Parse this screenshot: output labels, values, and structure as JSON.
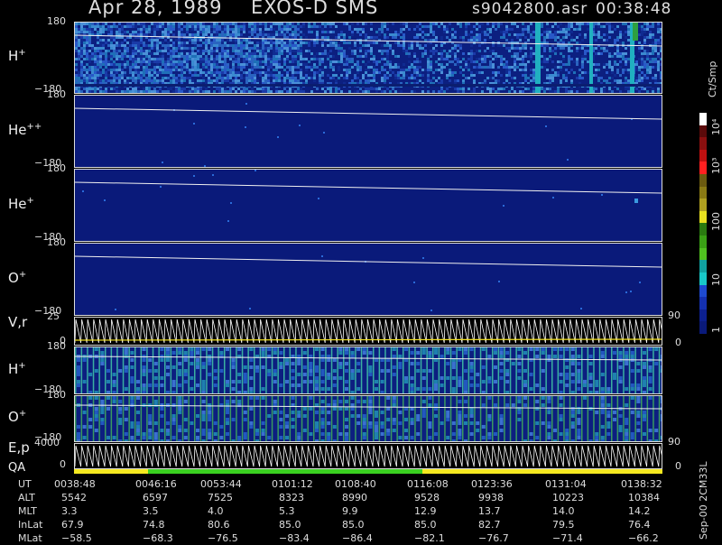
{
  "header": {
    "date": "Apr 28, 1989",
    "instrument": "EXOS-D SMS",
    "file": "s9042800.asr",
    "time": "00:38:48"
  },
  "panels": [
    {
      "id": "hplus1",
      "label": "H",
      "sup": "+",
      "top_tick": "180",
      "bottom_tick": "−180",
      "bg": "#0c1f80"
    },
    {
      "id": "hepp",
      "label": "He",
      "sup": "++",
      "top_tick": "180",
      "bottom_tick": "−180",
      "bg": "#0a1a7a"
    },
    {
      "id": "heplus",
      "label": "He",
      "sup": "+",
      "top_tick": "180",
      "bottom_tick": "−180",
      "bg": "#0a1a7a"
    },
    {
      "id": "oplus1",
      "label": "O",
      "sup": "+",
      "top_tick": "180",
      "bottom_tick": "−180",
      "bg": "#0a1a7a"
    },
    {
      "id": "vr",
      "label": "V,r",
      "sup": "",
      "top_tick": "25",
      "bottom_tick": "0",
      "right_top": "90",
      "right_bottom": "0",
      "bg": "#000"
    },
    {
      "id": "hplus2",
      "label": "H",
      "sup": "+",
      "top_tick": "180",
      "bottom_tick": "−180",
      "bg": "#0c1f80"
    },
    {
      "id": "oplus2",
      "label": "O",
      "sup": "+",
      "top_tick": "180",
      "bottom_tick": "−180",
      "bg": "#0c1f80"
    },
    {
      "id": "ep",
      "label": "E,p",
      "sup": "",
      "top_tick": "4000",
      "bottom_tick": "0",
      "right_top": "90",
      "right_bottom": "0",
      "bg": "#000"
    }
  ],
  "qa_label": "QA",
  "colorbar": {
    "unit": "Ct/Smp",
    "ticks": [
      "10⁴",
      "10³",
      "100",
      "10",
      "1"
    ],
    "colors": [
      "#ffffff",
      "#5a0a0a",
      "#8a0f0f",
      "#c01010",
      "#ff2020",
      "#6b5a10",
      "#8a7a14",
      "#b0a020",
      "#e8e020",
      "#2a7a10",
      "#3aa015",
      "#50c020",
      "#10a0a0",
      "#18c8c8",
      "#1e4ad0",
      "#1430b0",
      "#0c2090",
      "#0a1a7a"
    ]
  },
  "chart_data": {
    "type": "heatmap",
    "title": "Apr 28, 1989   EXOS-D SMS   s9042800.asr   00:38:48",
    "panels": [
      {
        "name": "H+",
        "ylim": [
          -180,
          180
        ]
      },
      {
        "name": "He++",
        "ylim": [
          -180,
          180
        ]
      },
      {
        "name": "He+",
        "ylim": [
          -180,
          180
        ]
      },
      {
        "name": "O+",
        "ylim": [
          -180,
          180
        ]
      },
      {
        "name": "V,r",
        "ylim": [
          0,
          25
        ],
        "y2lim": [
          0,
          90
        ]
      },
      {
        "name": "H+",
        "ylim": [
          -180,
          180
        ]
      },
      {
        "name": "O+",
        "ylim": [
          -180,
          180
        ]
      },
      {
        "name": "E,p",
        "ylim": [
          0,
          4000
        ],
        "y2lim": [
          0,
          90
        ]
      }
    ],
    "colorbar": {
      "label": "Ct/Smp",
      "scale": "log",
      "range": [
        1,
        10000
      ]
    }
  },
  "ephemeris": {
    "rows": [
      {
        "label": "UT",
        "values": [
          "0038:48",
          "0046:16",
          "0053:44",
          "0101:12",
          "0108:40",
          "0116:08",
          "0123:36",
          "0131:04",
          "0138:32"
        ]
      },
      {
        "label": "ALT",
        "values": [
          "5542",
          "6597",
          "7525",
          "8323",
          "8990",
          "9528",
          "9938",
          "10223",
          "10384"
        ]
      },
      {
        "label": "MLT",
        "values": [
          "3.3",
          "3.5",
          "4.0",
          "5.3",
          "9.9",
          "12.9",
          "13.7",
          "14.0",
          "14.2"
        ]
      },
      {
        "label": "InLat",
        "values": [
          "67.9",
          "74.8",
          "80.6",
          "85.0",
          "85.0",
          "85.0",
          "82.7",
          "79.5",
          "76.4"
        ]
      },
      {
        "label": "MLat",
        "values": [
          "−58.5",
          "−68.3",
          "−76.5",
          "−83.4",
          "−86.4",
          "−82.1",
          "−76.7",
          "−71.4",
          "−66.2"
        ]
      }
    ]
  },
  "side_note": "Sep-00 2CM33L"
}
